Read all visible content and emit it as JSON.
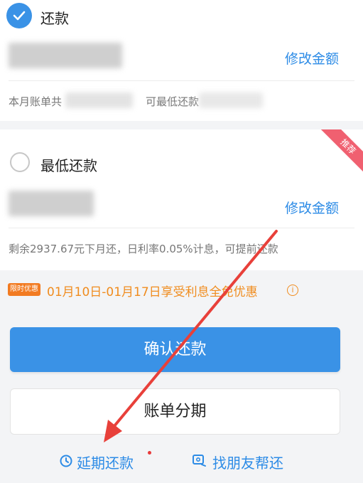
{
  "repay_full": {
    "label": "还款",
    "edit_amount": "修改金额",
    "bill_prefix": "本月账单共",
    "min_prefix": "可最低还款"
  },
  "repay_min": {
    "label": "最低还款",
    "edit_amount": "修改金额",
    "badge": "推荐",
    "note": "剩余2937.67元下月还，日利率0.05%计息，可提前还款"
  },
  "promo": {
    "badge": "限时优惠",
    "text": "01月10日-01月17日享受利息全免优惠"
  },
  "buttons": {
    "confirm": "确认还款",
    "installment": "账单分期"
  },
  "bottom_links": {
    "defer": "延期还款",
    "friend": "找朋友帮还"
  },
  "colors": {
    "accent": "#3a92e6",
    "promo_orange": "#f08c1e",
    "ribbon_red": "#f06070",
    "arrow_red": "#e8403a"
  },
  "icons": [
    "checkmark-icon",
    "radio-empty-icon",
    "info-icon",
    "clock-icon",
    "friend-help-icon"
  ]
}
